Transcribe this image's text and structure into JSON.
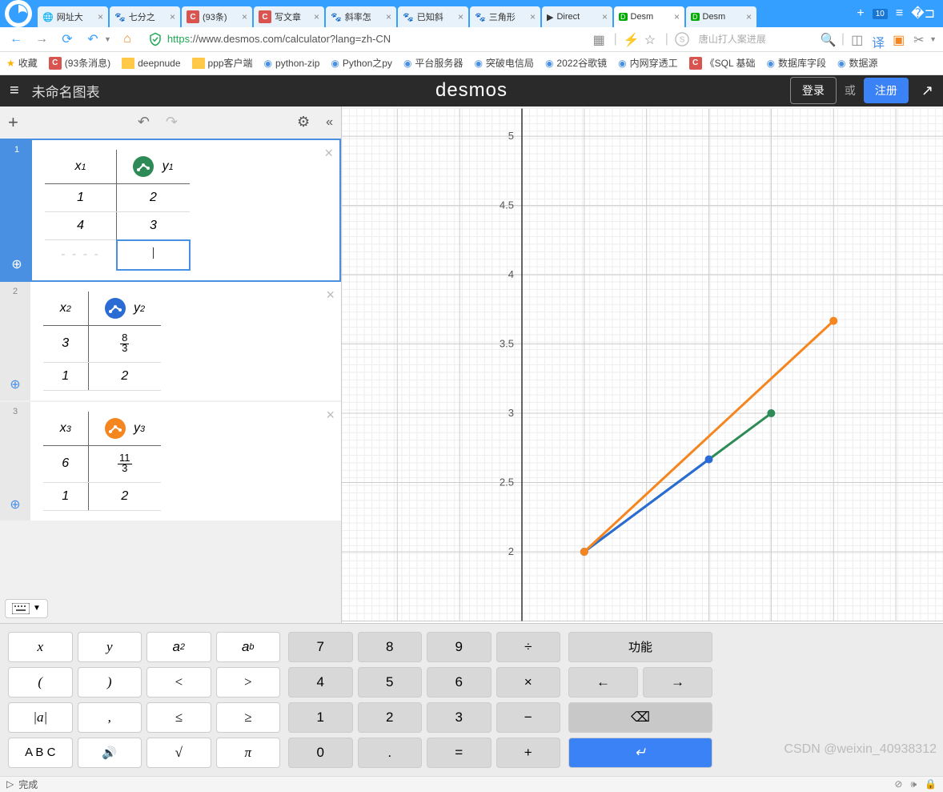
{
  "browser": {
    "tabs": [
      {
        "icon": "globe",
        "label": "网址大"
      },
      {
        "icon": "baidu",
        "label": "七分之"
      },
      {
        "icon": "csdn",
        "label": "(93条)"
      },
      {
        "icon": "csdn",
        "label": "写文章"
      },
      {
        "icon": "baidu",
        "label": "斜率怎"
      },
      {
        "icon": "baidu",
        "label": "已知斜"
      },
      {
        "icon": "baidu",
        "label": "三角形"
      },
      {
        "icon": "bili",
        "label": "Direct"
      },
      {
        "icon": "desmos",
        "label": "Desm",
        "active": true
      },
      {
        "icon": "desmos",
        "label": "Desm"
      }
    ],
    "tab_count": "10",
    "url_prefix": "https",
    "url_rest": "://www.desmos.com/calculator?lang=zh-CN",
    "search_placeholder": "唐山打人案进展",
    "bookmarks": [
      {
        "type": "star",
        "label": "收藏"
      },
      {
        "type": "csdn",
        "label": "(93条消息)"
      },
      {
        "type": "folder",
        "label": "deepnude"
      },
      {
        "type": "folder",
        "label": "ppp客户端"
      },
      {
        "type": "py",
        "label": "python-zip"
      },
      {
        "type": "py",
        "label": "Python之py"
      },
      {
        "type": "srv",
        "label": "平台服务器"
      },
      {
        "type": "ico",
        "label": "突破电信局"
      },
      {
        "type": "g",
        "label": "2022谷歌镜"
      },
      {
        "type": "ico",
        "label": "内网穿透工"
      },
      {
        "type": "csdn",
        "label": "《SQL 基础"
      },
      {
        "type": "ico",
        "label": "数据库字段"
      },
      {
        "type": "ico",
        "label": "数据源"
      }
    ]
  },
  "desmos": {
    "title": "未命名图表",
    "logo": "desmos",
    "login": "登录",
    "or": "或",
    "signup": "注册"
  },
  "expressions": [
    {
      "id": "1",
      "color": "#2e8b57",
      "xh": "x",
      "xsub": "1",
      "yh": "y",
      "ysub": "1",
      "rows": [
        [
          "1",
          "2"
        ],
        [
          "4",
          "3"
        ]
      ],
      "empty": true,
      "active": true
    },
    {
      "id": "2",
      "color": "#2a6bd4",
      "xh": "x",
      "xsub": "2",
      "yh": "y",
      "ysub": "2",
      "rows": [
        [
          "3",
          "8/3"
        ],
        [
          "1",
          "2"
        ]
      ]
    },
    {
      "id": "3",
      "color": "#f5851f",
      "xh": "x",
      "xsub": "3",
      "yh": "y",
      "ysub": "3",
      "rows": [
        [
          "6",
          "11/3"
        ],
        [
          "1",
          "2"
        ]
      ]
    }
  ],
  "chart_data": {
    "type": "scatter",
    "xlim": [
      0,
      6.5
    ],
    "ylim": [
      1.5,
      5.2
    ],
    "xticks": [],
    "yticks": [
      2,
      2.5,
      3,
      3.5,
      4,
      4.5,
      5
    ],
    "series": [
      {
        "name": "green-segment",
        "color": "#2e8b57",
        "points": [
          [
            1,
            2
          ],
          [
            4,
            3
          ]
        ],
        "line": true
      },
      {
        "name": "blue-segment",
        "color": "#2a6bd4",
        "points": [
          [
            1,
            2
          ],
          [
            3,
            2.667
          ]
        ],
        "line": true
      },
      {
        "name": "orange-segment",
        "color": "#f5851f",
        "points": [
          [
            1,
            2
          ],
          [
            5,
            3.667
          ]
        ],
        "line": true
      }
    ]
  },
  "keypad": {
    "sym": [
      [
        "x",
        "y",
        "a²",
        "aᵇ"
      ],
      [
        "(",
        ")",
        "<",
        ">"
      ],
      [
        "|a|",
        ",",
        "≤",
        "≥"
      ],
      [
        "A B C",
        "🔊",
        "√",
        "π"
      ]
    ],
    "num": [
      [
        "7",
        "8",
        "9",
        "÷"
      ],
      [
        "4",
        "5",
        "6",
        "×"
      ],
      [
        "1",
        "2",
        "3",
        "−"
      ],
      [
        "0",
        ".",
        "=",
        "+"
      ]
    ],
    "fn_label": "功能",
    "arrows": [
      "←",
      "→"
    ],
    "backspace": "⌫",
    "enter": "↵"
  },
  "status": {
    "done": "完成"
  },
  "watermark": "CSDN @weixin_40938312"
}
